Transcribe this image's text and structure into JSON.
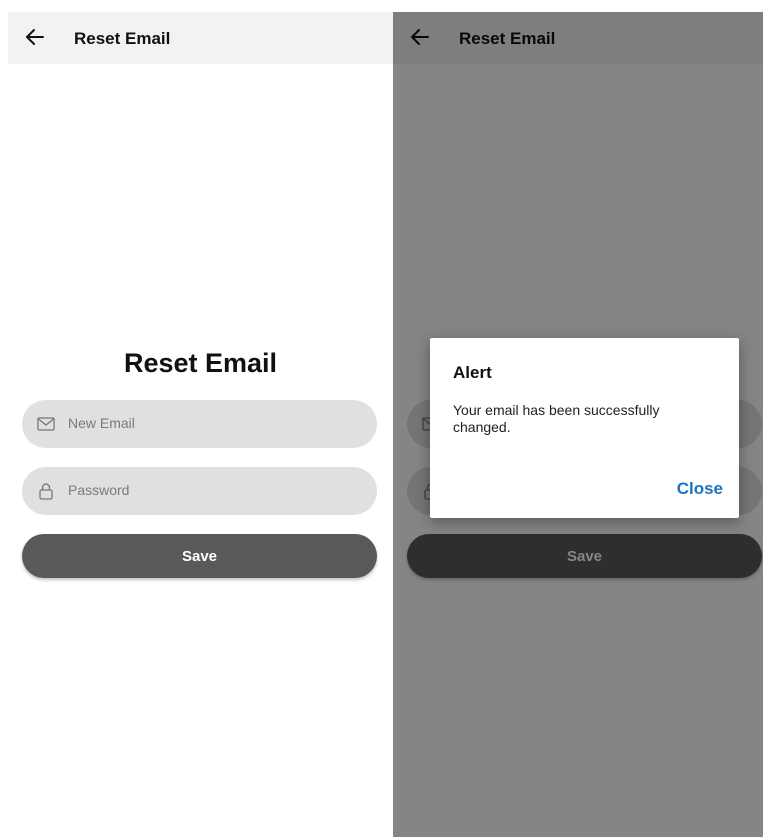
{
  "screens": [
    {
      "appbar": {
        "title": "Reset Email"
      },
      "heading": "Reset Email",
      "email_field": {
        "placeholder": "New Email"
      },
      "password_field": {
        "placeholder": "Password"
      },
      "save_label": "Save"
    },
    {
      "appbar": {
        "title": "Reset Email"
      },
      "save_label": "Save",
      "dialog": {
        "title": "Alert",
        "message": "Your email has been successfully changed.",
        "close_label": "Close"
      }
    }
  ],
  "icons": {
    "back": "arrow-left-icon",
    "email": "mail-icon",
    "password": "lock-icon"
  },
  "colors": {
    "appbar_bg": "#f2f2f2",
    "field_bg": "#e0e0e0",
    "button_bg": "#595959",
    "dialog_action": "#1a73c8"
  }
}
